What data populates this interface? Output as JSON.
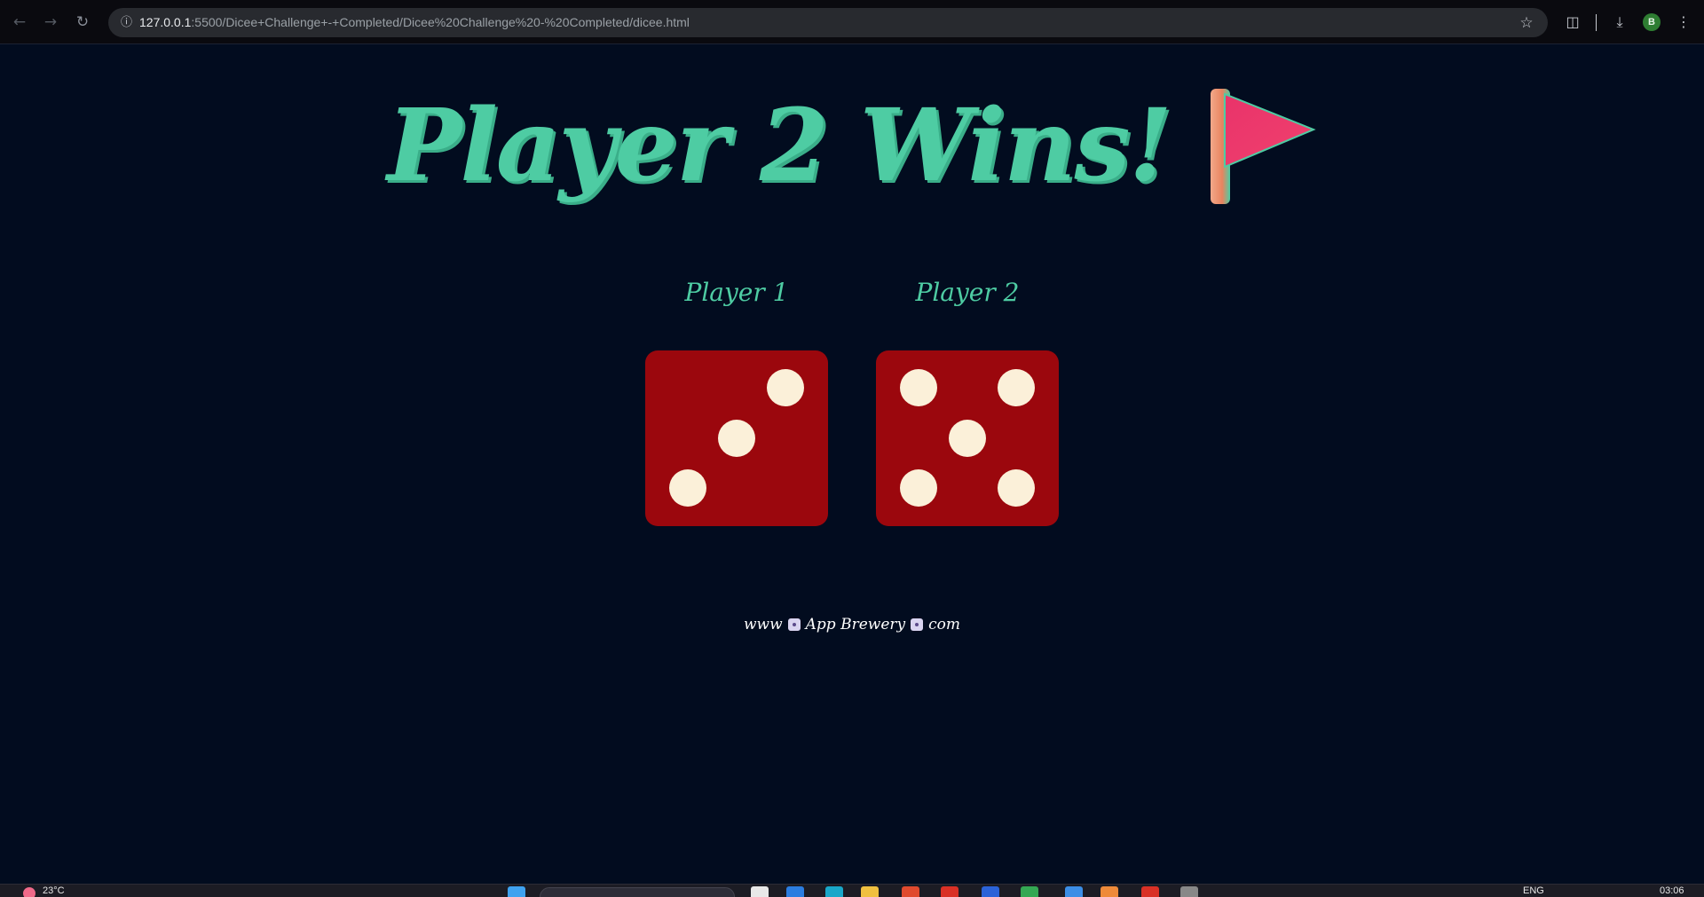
{
  "browser": {
    "url_host": "127.0.0.1",
    "url_rest": ":5500/Dicee+Challenge+-+Completed/Dicee%20Challenge%20-%20Completed/dicee.html",
    "profile_initial": "B",
    "icons": [
      "back-icon",
      "forward-icon",
      "reload-icon",
      "site-info-icon",
      "bookmark-star-icon",
      "extensions-icon",
      "download-icon",
      "menu-icon"
    ]
  },
  "page": {
    "title": "Player 2 Wins!",
    "title_icon": "red-flag",
    "players": [
      {
        "label": "Player 1",
        "die_value": 3
      },
      {
        "label": "Player 2",
        "die_value": 5
      }
    ],
    "footer": {
      "prefix": "www",
      "middle": "App Brewery",
      "suffix": "com"
    },
    "colors": {
      "background": "#020c1f",
      "accent": "#4ecca3",
      "die": "#9b070d",
      "pip": "#fbf0d9"
    }
  },
  "taskbar": {
    "weather": "23°C",
    "language": "ENG",
    "time": "03:06"
  }
}
